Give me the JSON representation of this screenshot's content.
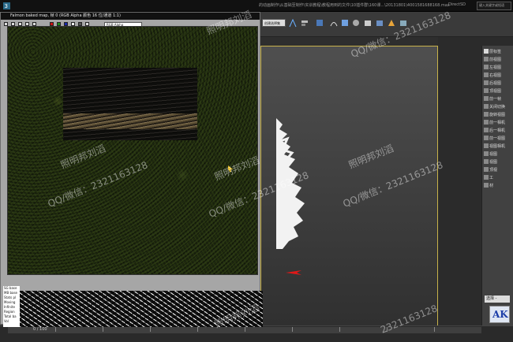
{
  "window": {
    "title_left": "Falmon baked map:",
    "title_left_2": "显示 gr",
    "title_center": "...",
    "title_path": "的动画制作\\从基础至制作\\实训教程\\教程用到的文件\\10插件群\\160课...\\20131801\\4001581688168.max",
    "title_mid": "- 3ds Max",
    "title_right": "DirectSD",
    "search_placeholder": "键入关键字或短语"
  },
  "toolbar": {
    "selection_set_label": "创建选择集"
  },
  "render_window": {
    "title": "Falmon baked map, 帧 0 (RGB Alpha 颜色 16 位/通道 1:1)",
    "channel_select": "RGB Alpha",
    "info_lines": [
      "SG base",
      "MB base",
      "Stats pl",
      "Moving",
      "Infinite",
      "Region",
      "Total ba",
      "Vol",
      "Total"
    ]
  },
  "right_panel": {
    "items": [
      "层标签",
      "前视图",
      "左视图",
      "右视图",
      "后视图",
      "顶视图",
      "前一帧",
      "关闭切换",
      "旋转视图",
      "前一相机",
      "后一相机",
      "前一视图",
      "视图相机",
      "视图",
      "视图",
      "顶视",
      "工",
      "材"
    ],
    "item_colors": [
      "#d9d9d9",
      "#8a8a8a",
      "#8a8a8a",
      "#8a8a8a",
      "#8a8a8a",
      "#8a8a8a",
      "#8a8a8a",
      "#8a8a8a",
      "#8a8a8a",
      "#8a8a8a",
      "#8a8a8a",
      "#8a8a8a",
      "#8a8a8a",
      "#8a8a8a",
      "#8a8a8a",
      "#8a8a8a",
      "#8a8a8a",
      "#8a8a8a"
    ],
    "combo_value": "选择 -",
    "logo_text": "AK"
  },
  "timeline": {
    "frame_label": "0 / 100"
  },
  "watermarks": [
    "照明邦刘滔",
    "QQ/微信：2321163128",
    "照明邦刘滔",
    "QQ/微信：2321163128",
    "照明邦刘滔",
    "QQ/微信：2321163128",
    "照明邦刘滔",
    "QQ/微信：2321163128",
    "照明邦刘滔",
    "2321163128"
  ],
  "colors": {
    "viewport_border": "#c7b24a",
    "axis_red": "#e01818",
    "rw_btn_red": "#cc1111",
    "rw_btn_green": "#1a8c1a",
    "rw_btn_blue": "#1a2aa8"
  },
  "icons": [
    "title-app-icon",
    "link-icon",
    "unlink-icon",
    "bind-icon",
    "select-icon",
    "select-name-icon",
    "region-icon",
    "move-icon",
    "rotate-icon",
    "scale-icon",
    "snap-icon",
    "mirror-icon",
    "align-icon",
    "layer-icon",
    "curve-icon",
    "schematic-icon",
    "material-icon",
    "render-setup-icon",
    "render-icon",
    "render-frame-icon"
  ]
}
